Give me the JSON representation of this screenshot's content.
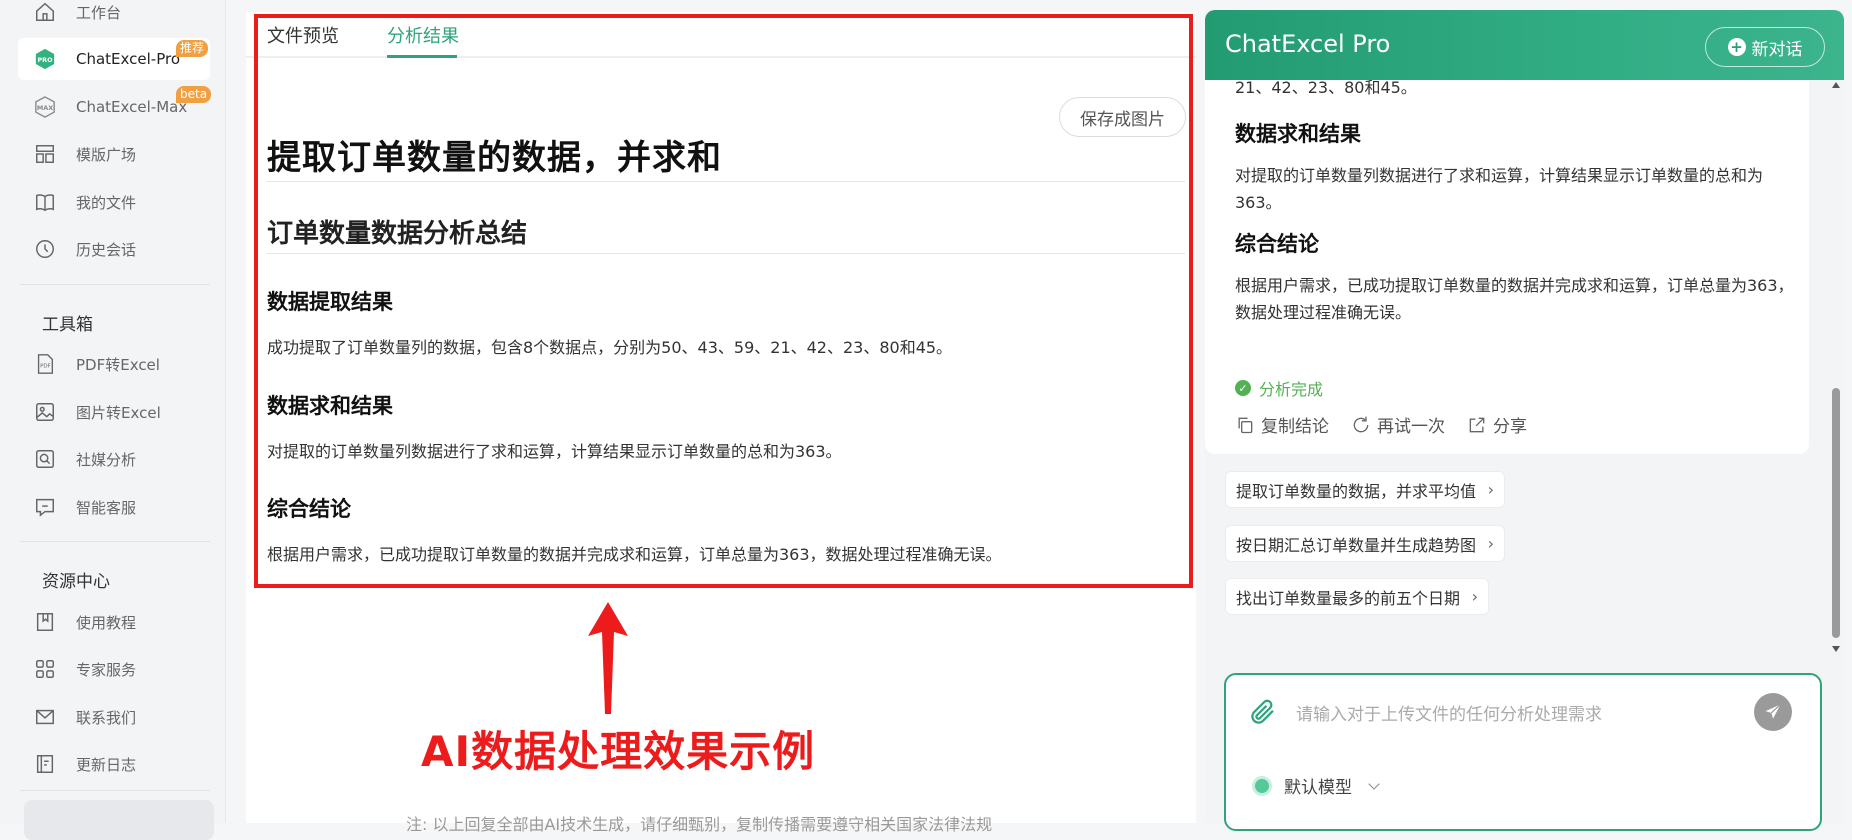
{
  "sidebar": {
    "nav": [
      {
        "label": "工作台",
        "icon": "home-icon"
      },
      {
        "label": "ChatExcel-Pro",
        "icon": "pro-logo-icon",
        "badge": "推荐"
      },
      {
        "label": "ChatExcel-Max",
        "icon": "max-logo-icon",
        "badge": "beta"
      },
      {
        "label": "模版广场",
        "icon": "template-grid-icon"
      },
      {
        "label": "我的文件",
        "icon": "book-icon"
      },
      {
        "label": "历史会话",
        "icon": "clock-icon"
      }
    ],
    "toolbox_title": "工具箱",
    "tools": [
      {
        "label": "PDF转Excel",
        "icon": "pdf-file-icon"
      },
      {
        "label": "图片转Excel",
        "icon": "image-icon"
      },
      {
        "label": "社媒分析",
        "icon": "search-square-icon"
      },
      {
        "label": "智能客服",
        "icon": "chat-bubble-icon"
      }
    ],
    "resources_title": "资源中心",
    "resources": [
      {
        "label": "使用教程",
        "icon": "bookmark-book-icon"
      },
      {
        "label": "专家服务",
        "icon": "apps-grid-icon"
      },
      {
        "label": "联系我们",
        "icon": "mail-icon"
      },
      {
        "label": "更新日志",
        "icon": "log-doc-icon"
      }
    ]
  },
  "main": {
    "tabs": [
      "文件预览",
      "分析结果"
    ],
    "active_tab": 1,
    "save_image_label": "保存成图片",
    "title": "提取订单数量的数据，并求和",
    "subtitle": "订单数量数据分析总结",
    "sections": [
      {
        "heading": "数据提取结果",
        "text": "成功提取了订单数量列的数据，包含8个数据点，分别为50、43、59、21、42、23、80和45。"
      },
      {
        "heading": "数据求和结果",
        "text": "对提取的订单数量列数据进行了求和运算，计算结果显示订单数量的总和为363。"
      },
      {
        "heading": "综合结论",
        "text": "根据用户需求，已成功提取订单数量的数据并完成求和运算，订单总量为363，数据处理过程准确无误。"
      }
    ],
    "annotation": "AI数据处理效果示例",
    "footnote": "注: 以上回复全部由AI技术生成，请仔细甄别，复制传播需要遵守相关国家法律法规"
  },
  "chat": {
    "title": "ChatExcel Pro",
    "new_chat_label": "新对话",
    "cut_text": "21、42、23、80和45。",
    "sum_heading": "数据求和结果",
    "sum_text": "对提取的订单数量列数据进行了求和运算，计算结果显示订单数量的总和为363。",
    "conclusion_heading": "综合结论",
    "conclusion_text": "根据用户需求，已成功提取订单数量的数据并完成求和运算，订单总量为363，数据处理过程准确无误。",
    "status": "分析完成",
    "actions": [
      "复制结论",
      "再试一次",
      "分享"
    ],
    "suggestions": [
      "提取订单数量的数据，并求平均值",
      "按日期汇总订单数量并生成趋势图",
      "找出订单数量最多的前五个日期"
    ],
    "input_placeholder": "请输入对于上传文件的任何分析处理需求",
    "model_label": "默认模型"
  },
  "colors": {
    "brand_green": "#2fa37d",
    "annotation_red": "#ec1c1c",
    "badge_orange": "#f0a040",
    "success_green": "#52b152"
  }
}
